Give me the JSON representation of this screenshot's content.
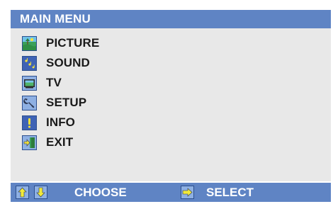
{
  "title": "MAIN  MENU",
  "menu": {
    "items": [
      {
        "label": "PICTURE",
        "icon": "picture-icon"
      },
      {
        "label": "SOUND",
        "icon": "sound-icon"
      },
      {
        "label": "TV",
        "icon": "tv-icon"
      },
      {
        "label": "SETUP",
        "icon": "setup-icon"
      },
      {
        "label": "INFO",
        "icon": "info-icon"
      },
      {
        "label": "EXIT",
        "icon": "exit-icon"
      }
    ]
  },
  "footer": {
    "choose_label": "CHOOSE",
    "select_label": "SELECT",
    "up_icon": "arrow-up-icon",
    "down_icon": "arrow-down-icon",
    "select_icon": "arrow-right-icon"
  },
  "colors": {
    "bar": "#5f84c4",
    "panel": "#e8e8e8",
    "icon_bg": "#8eb0e3",
    "arrow": "#f2ea3a"
  }
}
